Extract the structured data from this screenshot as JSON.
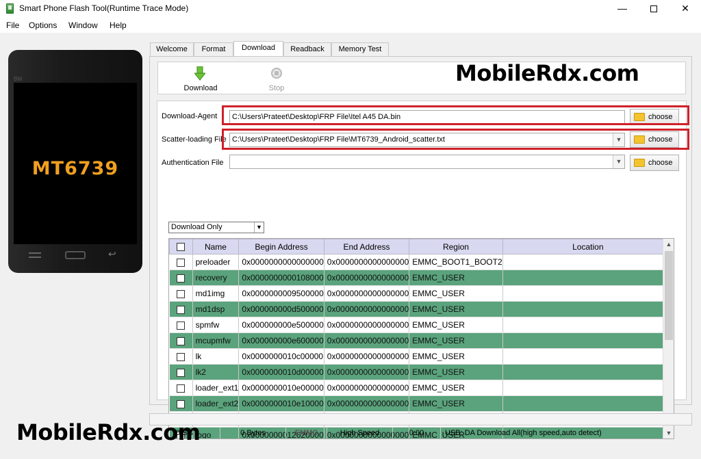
{
  "window": {
    "title": "Smart Phone Flash Tool(Runtime Trace Mode)",
    "minimize_icon": "minimize-icon",
    "maximize_icon": "maximize-icon",
    "close_icon": "close-icon",
    "minimize_glyph": "—",
    "close_glyph": "✕"
  },
  "menu": [
    "File",
    "Options",
    "Window",
    "Help"
  ],
  "phone": {
    "speaker_text": "BM",
    "model": "MT6739",
    "back_glyph": "↩"
  },
  "tabs": [
    "Welcome",
    "Format",
    "Download",
    "Readback",
    "Memory Test"
  ],
  "active_tab": "Download",
  "toolbar": {
    "download_label": "Download",
    "stop_label": "Stop"
  },
  "watermark": "MobileRdx.com",
  "form": {
    "download_agent_label": "Download-Agent",
    "download_agent_value": "C:\\Users\\Prateet\\Desktop\\FRP File\\Itel A45 DA.bin",
    "scatter_label": "Scatter-loading File",
    "scatter_value": "C:\\Users\\Prateet\\Desktop\\FRP File\\MT6739_Android_scatter.txt",
    "auth_label": "Authentication File",
    "auth_value": "",
    "choose_label": "choose",
    "mode_value": "Download Only",
    "dropdown_glyph": "▼"
  },
  "table": {
    "headers": [
      "Name",
      "Begin Address",
      "End Address",
      "Region",
      "Location"
    ],
    "rows": [
      {
        "name": "preloader",
        "begin": "0x0000000000000000",
        "end": "0x0000000000000000",
        "region": "EMMC_BOOT1_BOOT2",
        "location": ""
      },
      {
        "name": "recovery",
        "begin": "0x0000000000108000",
        "end": "0x0000000000000000",
        "region": "EMMC_USER",
        "location": ""
      },
      {
        "name": "md1img",
        "begin": "0x0000000009500000",
        "end": "0x0000000000000000",
        "region": "EMMC_USER",
        "location": ""
      },
      {
        "name": "md1dsp",
        "begin": "0x000000000d500000",
        "end": "0x0000000000000000",
        "region": "EMMC_USER",
        "location": ""
      },
      {
        "name": "spmfw",
        "begin": "0x000000000e500000",
        "end": "0x0000000000000000",
        "region": "EMMC_USER",
        "location": ""
      },
      {
        "name": "mcupmfw",
        "begin": "0x000000000e600000",
        "end": "0x0000000000000000",
        "region": "EMMC_USER",
        "location": ""
      },
      {
        "name": "lk",
        "begin": "0x0000000010c00000",
        "end": "0x0000000000000000",
        "region": "EMMC_USER",
        "location": ""
      },
      {
        "name": "lk2",
        "begin": "0x0000000010d00000",
        "end": "0x0000000000000000",
        "region": "EMMC_USER",
        "location": ""
      },
      {
        "name": "loader_ext1",
        "begin": "0x0000000010e00000",
        "end": "0x0000000000000000",
        "region": "EMMC_USER",
        "location": ""
      },
      {
        "name": "loader_ext2",
        "begin": "0x0000000010e10000",
        "end": "0x0000000000000000",
        "region": "EMMC_USER",
        "location": ""
      },
      {
        "name": "boot",
        "begin": "0x0000000010e20000",
        "end": "0x0000000000000000",
        "region": "EMMC_USER",
        "location": ""
      },
      {
        "name": "logo",
        "begin": "0x0000000012620000",
        "end": "0x0000000000000000",
        "region": "EMMC_USER",
        "location": ""
      }
    ],
    "scroll_up_glyph": "▲",
    "scroll_down_glyph": "▼"
  },
  "status": {
    "speed": "0 B/s",
    "bytes": "0 Bytes",
    "storage": "EMMC",
    "mode": "High Speed",
    "time": "0:00",
    "usb": "USB: DA Download All(high speed,auto detect)"
  },
  "colors": {
    "highlight_row": "#5aa37c",
    "red_outline": "#d0202a",
    "phone_text": "#f0a020"
  }
}
